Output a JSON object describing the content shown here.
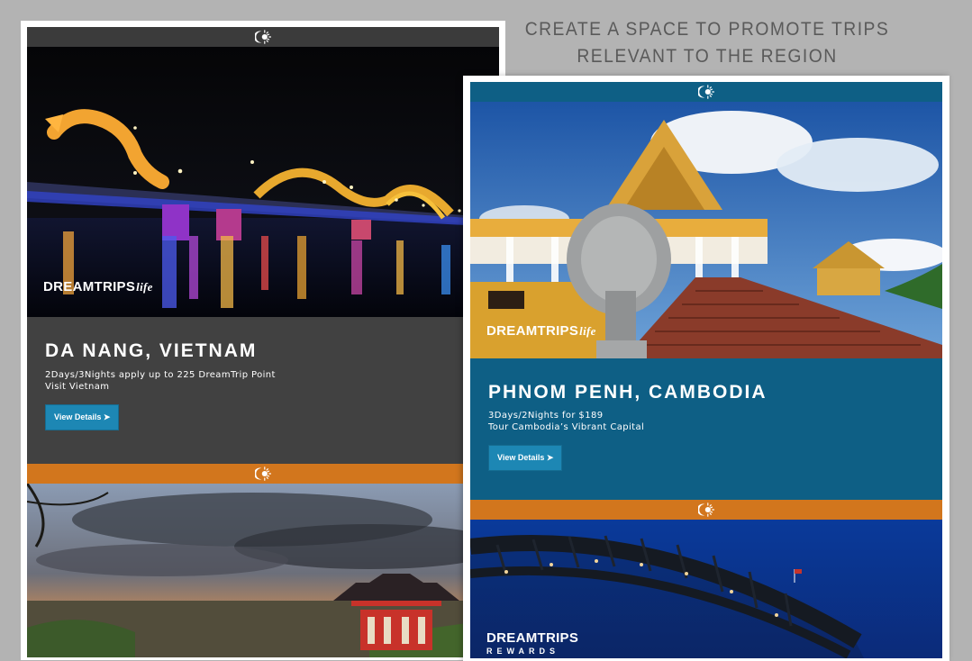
{
  "headline": {
    "line1": "CREATE A SPACE TO PROMOTE TRIPS",
    "line2": "RELEVANT TO THE REGION"
  },
  "icons": {
    "logo": "sun-burst-icon",
    "arrow": "play-arrow-icon"
  },
  "colors": {
    "background": "#b3b3b3",
    "dark_bar": "#3b3b3b",
    "dark_panel": "#414141",
    "teal": "#0e5f85",
    "orange": "#d2761d",
    "button": "#1d87b4"
  },
  "left_email": {
    "feature": {
      "brand": "DREAMTRIPS",
      "brand_suffix": "life",
      "title": "DA NANG, VIETNAM",
      "line1": "2Days/3Nights apply up to 225 DreamTrip Point",
      "line2": "Visit Vietnam",
      "button": "View Details ➤"
    }
  },
  "right_email": {
    "feature": {
      "brand": "DREAMTRIPS",
      "brand_suffix": "life",
      "title": "PHNOM PENH, CAMBODIA",
      "line1": "3Days/2Nights for $189",
      "line2": "Tour Cambodia’s Vibrant Capital",
      "button": "View Details ➤"
    },
    "secondary": {
      "brand": "DREAMTRIPS",
      "brand_sub": "REWARDS"
    }
  }
}
